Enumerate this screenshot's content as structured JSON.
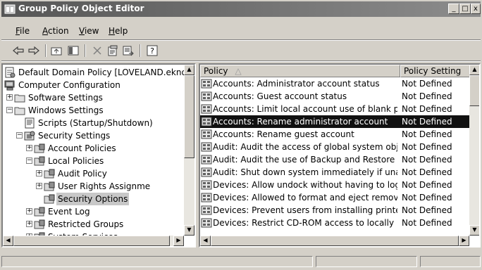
{
  "window": {
    "title": "Group Policy Object Editor",
    "minimize_label": "_",
    "maximize_label": "□",
    "close_label": "x"
  },
  "menu": [
    {
      "label": "File",
      "key": "F",
      "rest": "ile"
    },
    {
      "label": "Action",
      "key": "A",
      "rest": "ction"
    },
    {
      "label": "View",
      "key": "V",
      "rest": "iew"
    },
    {
      "label": "Help",
      "key": "H",
      "rest": "elp"
    }
  ],
  "toolbar": {
    "icons": [
      "back-arrow-icon",
      "forward-arrow-icon",
      "up-folder-icon",
      "show-hide-tree-icon",
      "delete-icon",
      "properties-icon",
      "export-list-icon",
      "help-icon"
    ]
  },
  "tree": {
    "items": [
      {
        "label": "Default Domain Policy [LOVELAND.eknow",
        "icon": "policy-icon",
        "expander": ""
      },
      {
        "label": "Computer Configuration",
        "icon": "computer-icon",
        "expander": "−"
      },
      {
        "label": "Software Settings",
        "icon": "folder-icon",
        "expander": "+"
      },
      {
        "label": "Windows Settings",
        "icon": "folder-icon",
        "expander": "−"
      },
      {
        "label": "Scripts (Startup/Shutdown)",
        "icon": "script-icon",
        "expander": ""
      },
      {
        "label": "Security Settings",
        "icon": "security-icon",
        "expander": "−"
      },
      {
        "label": "Account Policies",
        "icon": "security-folder-icon",
        "expander": "+"
      },
      {
        "label": "Local Policies",
        "icon": "security-folder-icon",
        "expander": "−"
      },
      {
        "label": "Audit Policy",
        "icon": "security-folder-icon",
        "expander": "+"
      },
      {
        "label": "User Rights Assignme",
        "icon": "security-folder-icon",
        "expander": "+"
      },
      {
        "label": "Security Options",
        "icon": "security-folder-icon",
        "expander": ""
      },
      {
        "label": "Event Log",
        "icon": "security-folder-icon",
        "expander": "+"
      },
      {
        "label": "Restricted Groups",
        "icon": "security-folder-icon",
        "expander": "+"
      },
      {
        "label": "System Services",
        "icon": "security-folder-icon",
        "expander": "+"
      }
    ]
  },
  "list": {
    "columns": [
      "Policy",
      "Policy Setting"
    ],
    "sort_indicator": "△",
    "rows": [
      {
        "policy": "Accounts: Administrator account status",
        "setting": "Not Defined",
        "selected": false
      },
      {
        "policy": "Accounts: Guest account status",
        "setting": "Not Defined",
        "selected": false
      },
      {
        "policy": "Accounts: Limit local account use of blank pa...",
        "setting": "Not Defined",
        "selected": false
      },
      {
        "policy": "Accounts: Rename administrator account",
        "setting": "Not Defined",
        "selected": true
      },
      {
        "policy": "Accounts: Rename guest account",
        "setting": "Not Defined",
        "selected": false
      },
      {
        "policy": "Audit: Audit the access of global system obje...",
        "setting": "Not Defined",
        "selected": false
      },
      {
        "policy": "Audit: Audit the use of Backup and Restore ...",
        "setting": "Not Defined",
        "selected": false
      },
      {
        "policy": "Audit: Shut down system immediately if unab...",
        "setting": "Not Defined",
        "selected": false
      },
      {
        "policy": "Devices: Allow undock without having to log on",
        "setting": "Not Defined",
        "selected": false
      },
      {
        "policy": "Devices: Allowed to format and eject remova...",
        "setting": "Not Defined",
        "selected": false
      },
      {
        "policy": "Devices: Prevent users from installing printer...",
        "setting": "Not Defined",
        "selected": false
      },
      {
        "policy": "Devices: Restrict CD-ROM access to locally lo...",
        "setting": "Not Defined",
        "selected": false
      }
    ]
  },
  "scroll": {
    "up_arrow": "▲",
    "down_arrow": "▼",
    "left_arrow": "◀",
    "right_arrow": "▶"
  }
}
